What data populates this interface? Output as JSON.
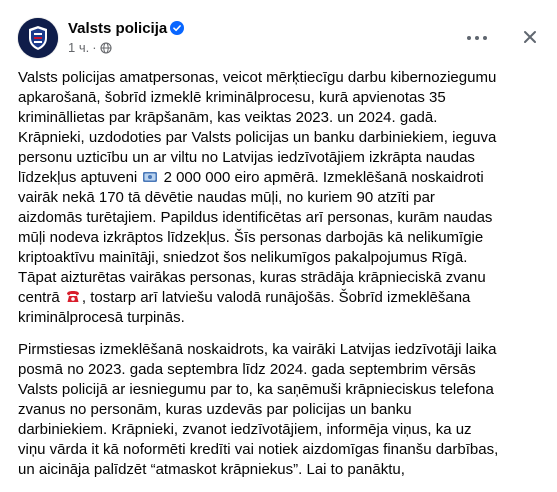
{
  "post": {
    "page_name": "Valsts policija",
    "time": "1 ч.",
    "dot": "·",
    "paragraph1": {
      "part1": "Valsts policijas amatpersonas, veicot mērķtiecīgu darbu kibernoziegumu apkarošanā, šobrīd izmeklē kriminālprocesu, kurā apvienotas 35 krimināllietas par krāpšanām, kas veiktas 2023. un 2024. gadā. Krāpnieki, uzdodoties par Valsts policijas un banku darbiniekiem, ieguva personu uzticību un ar viltu no Latvijas iedzīvotājiem izkrāpta naudas līdzekļus aptuveni ",
      "part2": " 2 000 000 eiro apmērā. Izmeklēšanā noskaidroti vairāk nekā 170 tā dēvētie naudas mūļi, no kuriem 90 atzīti par aizdomās turētajiem. Papildus identificētas arī personas, kurām naudas mūļi nodeva izkrāptos līdzekļus. Šīs personas darbojās kā nelikumīgie kriptoaktīvu mainītāji, sniedzot šos nelikumīgos pakalpojumus Rīgā. Tāpat aizturētas vairākas personas, kuras strādāja krāpnieciskā zvanu centrā ",
      "part3": ", tostarp arī latviešu valodā runājošās. Šobrīd izmeklēšana kriminālprocesā turpinās."
    },
    "paragraph2": "Pirmstiesas izmeklēšanā noskaidrots, ka vairāki Latvijas iedzīvotāji laika posmā no 2023. gada septembra līdz 2024. gada septembrim vērsās Valsts policijā ar iesniegumu par to, ka saņēmuši krāpnieciskus telefona zvanus no personām, kuras uzdevās par policijas un banku darbiniekiem. Krāpnieki, zvanot iedzīvotājiem, informēja viņus, ka uz viņu vārda it kā noformēti kredīti vai notiek aizdomīgas finanšu darbības, un aicināja palīdzēt “atmaskot krāpniekus”. Lai to panāktu,"
  },
  "icons": {
    "avatar": "police-logo",
    "verified": "verified-badge-icon",
    "audience": "globe-icon",
    "more": "more-icon",
    "close": "close-icon",
    "emoji1": "money-emoji",
    "emoji2": "telephone-emoji"
  },
  "colors": {
    "verified": "#0866ff",
    "secondary_text": "#65676b",
    "avatar_bg": "#0f1d4a"
  }
}
